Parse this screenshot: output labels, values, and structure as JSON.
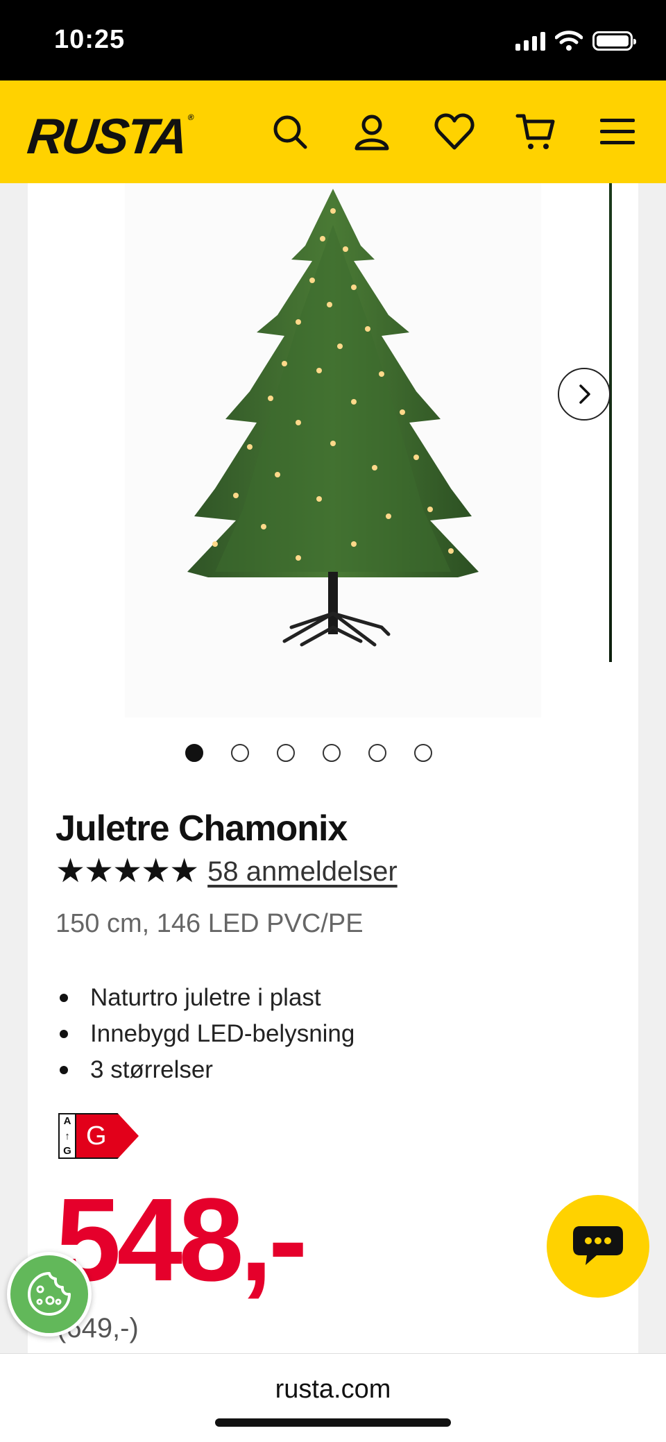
{
  "status_bar": {
    "time": "10:25"
  },
  "header": {
    "logo": "RUSTA",
    "logo_mark": "®",
    "icons": [
      "search-icon",
      "account-icon",
      "wishlist-heart-icon",
      "cart-icon",
      "menu-icon"
    ]
  },
  "gallery": {
    "image_alt": "Juletre Chamonix",
    "dots_count": 6,
    "active_index": 0
  },
  "product": {
    "title": "Juletre Chamonix",
    "stars": "★★★★★",
    "rating_stars": 5,
    "reviews": "58 anmeldelser",
    "variant": "150 cm, 146 LED PVC/PE",
    "features": [
      "Naturtro juletre i plast",
      "Innebygd LED-belysning",
      "3 størrelser"
    ],
    "energy_label": {
      "scale_top": "A",
      "scale_bottom": "G",
      "class": "G",
      "color": "#e2001a"
    },
    "price": "548,-",
    "old_price": "(649,-)"
  },
  "browser": {
    "url": "rusta.com"
  },
  "colors": {
    "brand_yellow": "#ffd200",
    "price_red": "#e5002b",
    "cookie_green": "#62b85a"
  }
}
